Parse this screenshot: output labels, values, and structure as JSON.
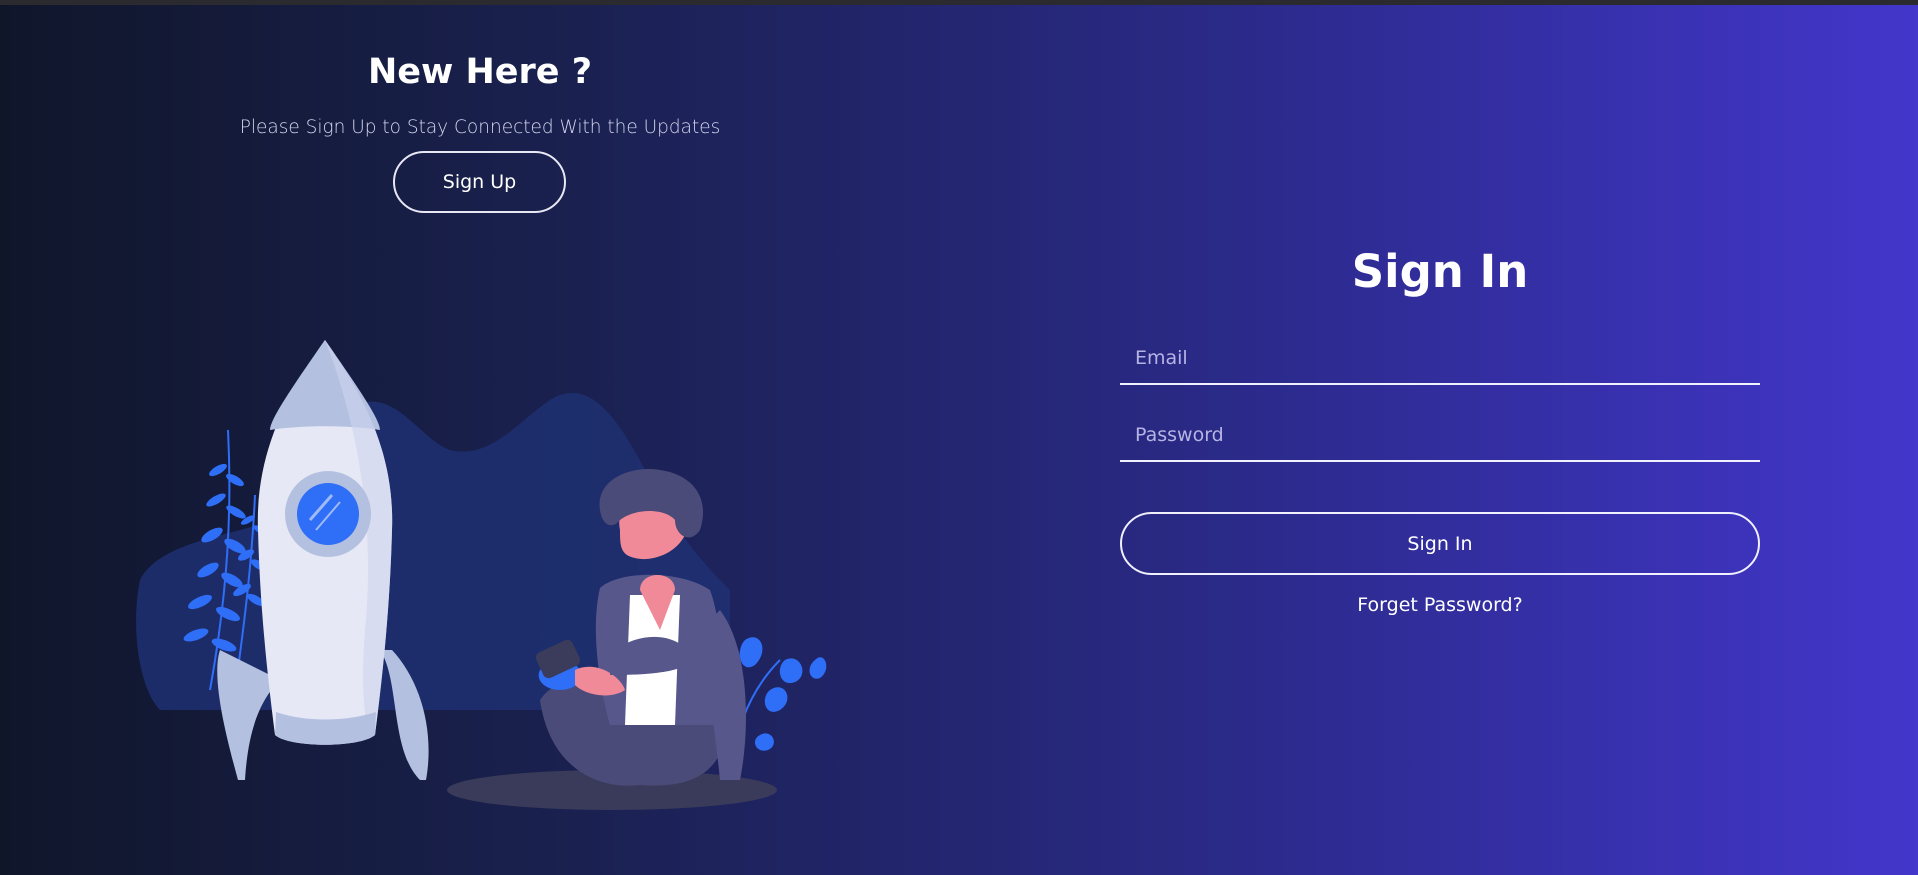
{
  "left_panel": {
    "title": "New Here ?",
    "subtitle": "Please Sign Up to Stay Connected With the Updates",
    "signup_label": "Sign Up"
  },
  "form": {
    "title": "Sign In",
    "email_placeholder": "Email",
    "password_placeholder": "Password",
    "signin_label": "Sign In",
    "forget_label": "Forget Password?"
  },
  "illustration": {
    "icons": [
      "rocket-icon",
      "person-with-phone-icon",
      "plant-icon",
      "mountain-icon"
    ]
  },
  "colors": {
    "bg_start": "#10162a",
    "bg_end": "#4236cb",
    "accent_blue": "#2f6ef6",
    "rocket_body": "#e6e8f5",
    "rocket_fin": "#b3c0e0"
  }
}
